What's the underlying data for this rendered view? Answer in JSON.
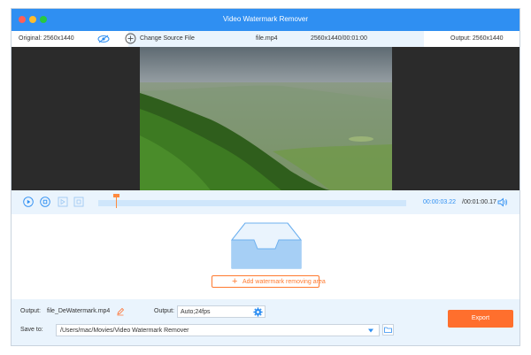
{
  "window": {
    "title": "Video Watermark Remover"
  },
  "infobar": {
    "original_label": "Original: 2560x1440",
    "change_source_label": "Change Source File",
    "file_name": "file.mp4",
    "file_info": "2560x1440/00:01:00",
    "output_label": "Output: 2560x1440"
  },
  "timeline": {
    "current_time": "00:00:03.22",
    "total_time": "/00:01:00.17",
    "progress": 0.06
  },
  "drop_area": {
    "add_label": "Add watermark removing area"
  },
  "bottom": {
    "output_label": "Output:",
    "output_file": "file_DeWatermark.mp4",
    "format_label": "Output:",
    "format_value": "Auto;24fps",
    "save_label": "Save to:",
    "save_path": "/Users/mac/Movies/Video Watermark Remover",
    "export_label": "Export"
  },
  "colors": {
    "accent": "#2f8ff2",
    "export": "#ff6f2d",
    "panel": "#eaf4fd"
  },
  "icons": [
    "eye-off-icon",
    "plus-circle-icon",
    "play-icon",
    "stop-icon",
    "clip-start-icon",
    "clip-end-icon",
    "volume-icon",
    "tray-icon",
    "edit-icon",
    "gear-icon",
    "dropdown-icon",
    "folder-icon"
  ]
}
